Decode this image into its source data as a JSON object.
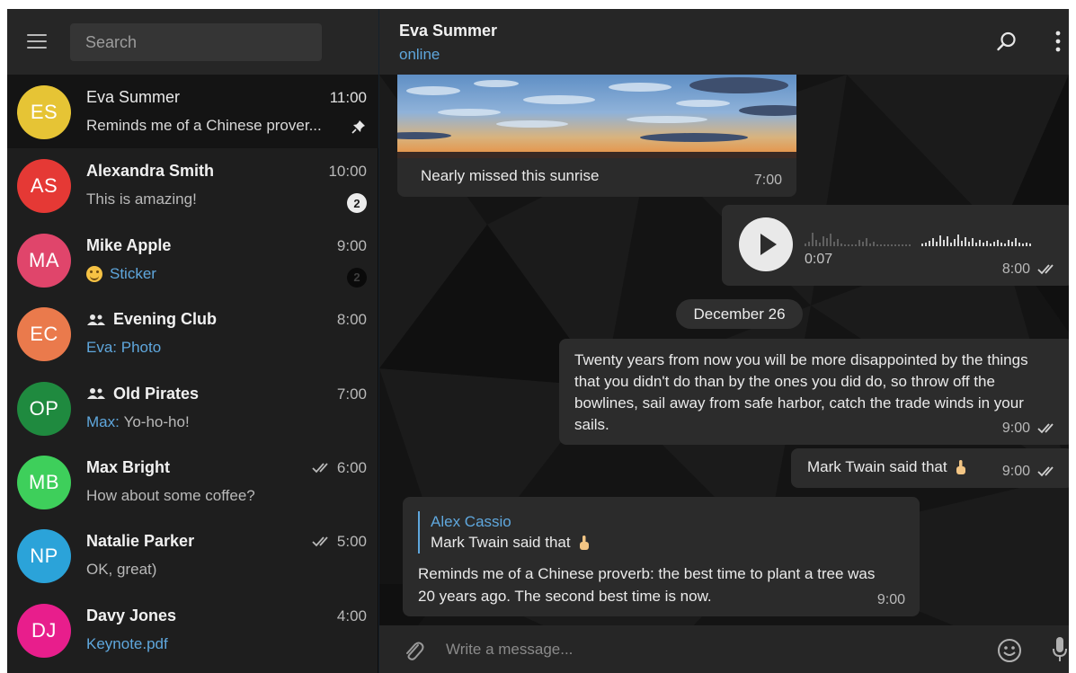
{
  "colors": {
    "accent": "#5fa7dd",
    "sidebar_bg": "#1e1e1e",
    "header_bg": "#262626",
    "bubble_bg": "#2b2b2b"
  },
  "sidebar": {
    "menu_icon": "hamburger-icon",
    "search_placeholder": "Search",
    "chats": [
      {
        "initials": "ES",
        "name": "Eva Summer",
        "time": "11:00",
        "preview": "Reminds me of a Chinese prover...",
        "avatar_color": "#e6c435",
        "active": true,
        "pinned": true
      },
      {
        "initials": "AS",
        "name": "Alexandra Smith",
        "time": "10:00",
        "preview": "This is amazing!",
        "avatar_color": "#e53935",
        "unread": "2"
      },
      {
        "initials": "MA",
        "name": "Mike Apple",
        "time": "9:00",
        "preview": "Sticker",
        "avatar_color": "#e0456b",
        "unread": "2",
        "muted": true
      },
      {
        "initials": "EC",
        "name": "Evening Club",
        "time": "8:00",
        "preview_sender": "Eva: Photo",
        "preview": "",
        "avatar_color": "#ea7a4c",
        "group": true
      },
      {
        "initials": "OP",
        "name": "Old Pirates",
        "time": "7:00",
        "preview_sender": "Max:",
        "preview": "Yo-ho-ho!",
        "avatar_color": "#1f8a3f",
        "group": true
      },
      {
        "initials": "MB",
        "name": "Max Bright",
        "time": "6:00",
        "preview": "How about some coffee?",
        "avatar_color": "#3ecf5b",
        "read": true
      },
      {
        "initials": "NP",
        "name": "Natalie Parker",
        "time": "5:00",
        "preview": "OK, great)",
        "avatar_color": "#2ba3d9",
        "read": true
      },
      {
        "initials": "DJ",
        "name": "Davy Jones",
        "time": "4:00",
        "preview": "Keynote.pdf",
        "avatar_color": "#e81e8c"
      }
    ]
  },
  "header": {
    "name": "Eva Summer",
    "status": "online"
  },
  "messages": {
    "photo": {
      "caption": "Nearly missed this sunrise",
      "time": "7:00"
    },
    "voice": {
      "duration": "0:07",
      "time": "8:00"
    },
    "date_separator": "December 26",
    "quote": {
      "text": "Twenty years from now you will be more disappointed by the things that you didn't do than by the ones you did do, so throw off the bowlines, sail away from safe harbor, catch the trade winds in your sails.",
      "time": "9:00"
    },
    "mark": {
      "text": "Mark Twain said that",
      "time": "9:00"
    },
    "reply": {
      "reply_author": "Alex Cassio",
      "reply_text": "Mark Twain said that",
      "text": "Reminds me of a Chinese proverb: the best time to plant a tree was 20 years ago. The second best time is now.",
      "time": "9:00"
    }
  },
  "composer": {
    "placeholder": "Write a message..."
  }
}
